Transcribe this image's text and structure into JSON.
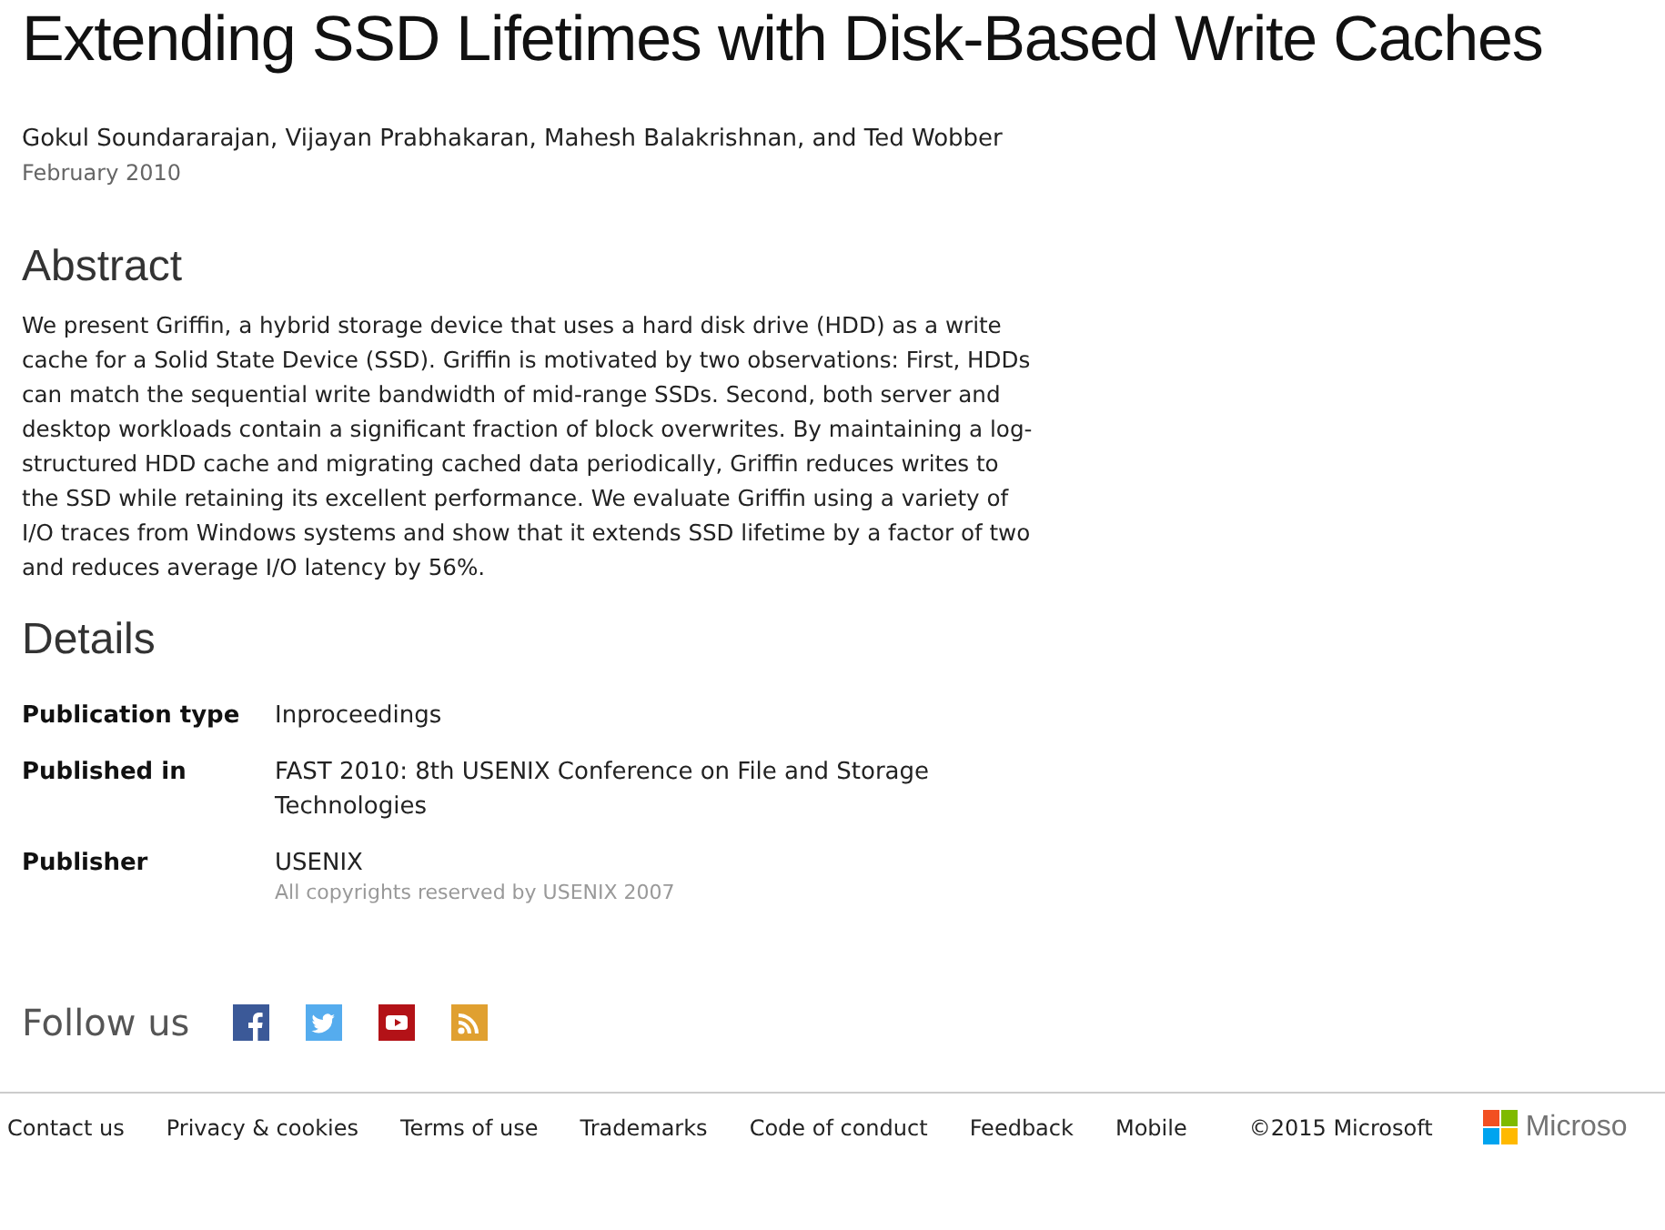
{
  "title": "Extending SSD Lifetimes with Disk-Based Write Caches",
  "authors": "Gokul Soundararajan, Vijayan Prabhakaran, Mahesh Balakrishnan, and Ted Wobber",
  "date": "February 2010",
  "abstract": {
    "heading": "Abstract",
    "text": "We present Griffin, a hybrid storage device that uses a hard disk drive (HDD) as a write cache for a Solid State Device (SSD). Griffin is motivated by two observations: First, HDDs can match the sequential write bandwidth of mid-range SSDs. Second, both server and desktop workloads contain a significant fraction of block overwrites. By maintaining a log-structured HDD cache and migrating cached data periodically, Griffin reduces writes to the SSD while retaining its excellent performance. We evaluate Griffin using a variety of I/O traces from Windows systems and show that it extends SSD lifetime by a factor of two and reduces average I/O latency by 56%."
  },
  "details": {
    "heading": "Details",
    "rows": [
      {
        "label": "Publication type",
        "value": "Inproceedings"
      },
      {
        "label": "Published in",
        "value": "FAST 2010: 8th USENIX Conference on File and Storage Technologies"
      },
      {
        "label": "Publisher",
        "value": "USENIX",
        "note": "All copyrights reserved by USENIX 2007"
      }
    ]
  },
  "follow": {
    "label": "Follow us",
    "icons": [
      {
        "kind": "facebook"
      },
      {
        "kind": "twitter"
      },
      {
        "kind": "youtube"
      },
      {
        "kind": "rss"
      }
    ]
  },
  "footer": {
    "links": [
      "Contact us",
      "Privacy & cookies",
      "Terms of use",
      "Trademarks",
      "Code of conduct",
      "Feedback",
      "Mobile"
    ],
    "copyright": "©2015 Microsoft",
    "logo_text": "Microso"
  }
}
